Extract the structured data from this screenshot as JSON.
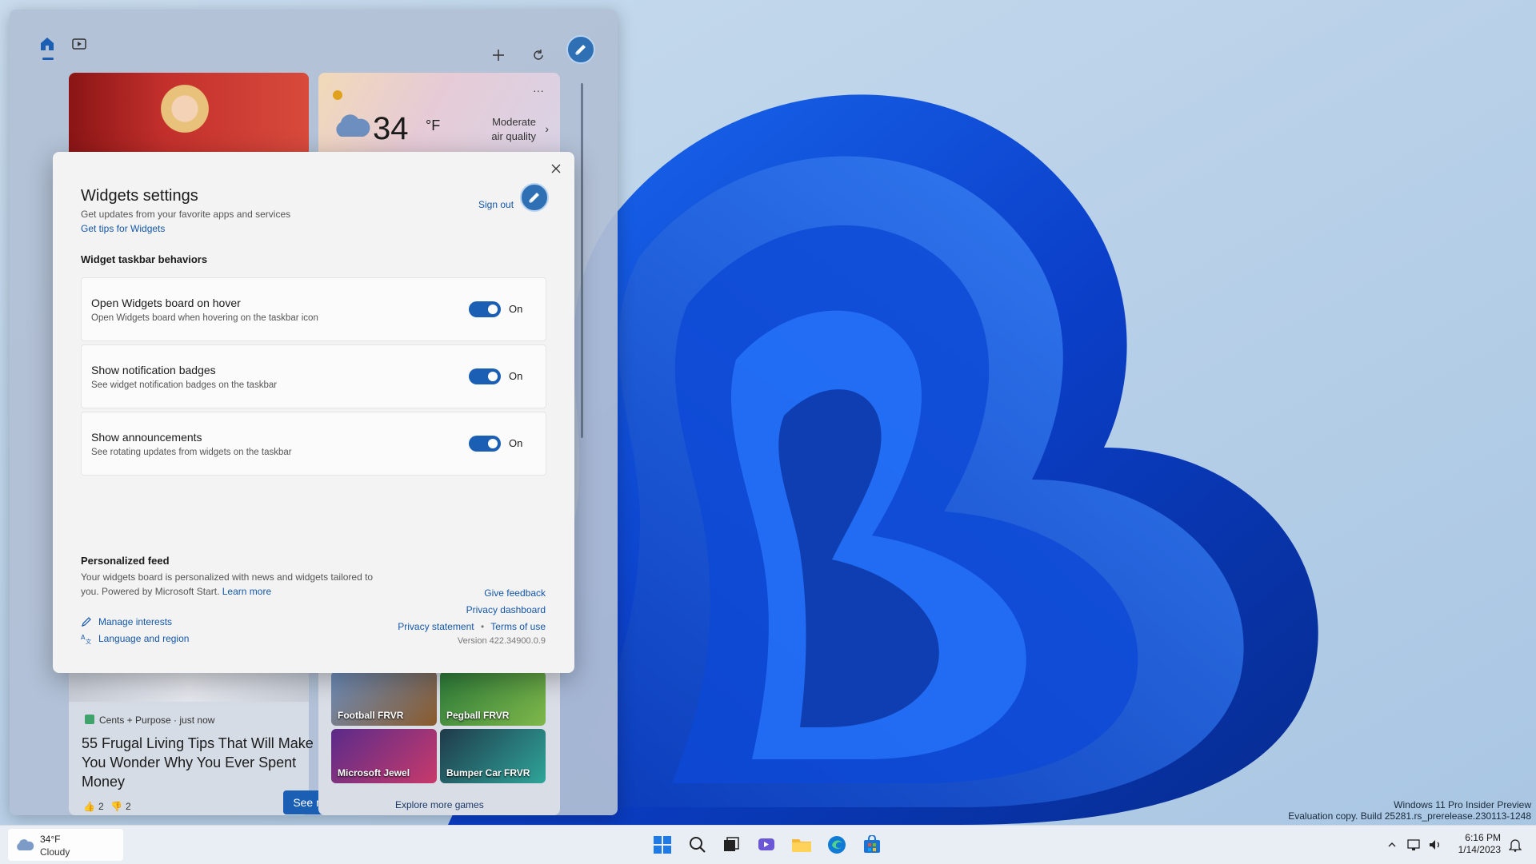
{
  "watermark": {
    "line1": "Windows 11 Pro Insider Preview",
    "line2": "Evaluation copy. Build 25281.rs_prerelease.230113-1248"
  },
  "board": {
    "tabs": [
      {
        "name": "home-icon",
        "active": true
      },
      {
        "name": "video-icon",
        "active": false
      }
    ],
    "weather": {
      "temp": "34",
      "unit": "°F",
      "air_quality_line1": "Moderate",
      "air_quality_line2": "air quality",
      "more": "···"
    },
    "news": {
      "source": "Cents + Purpose · just now",
      "title": "55 Frugal Living Tips That Will Make You Wonder Why You Ever Spent Money",
      "likes": "2",
      "dislikes": "2"
    },
    "see_more": "See more",
    "games": [
      "Football FRVR",
      "Pegball FRVR",
      "Microsoft Jewel",
      "Bumper Car FRVR"
    ],
    "explore_games": "Explore more games"
  },
  "dialog": {
    "title": "Widgets settings",
    "subtitle": "Get updates from your favorite apps and services",
    "tips_link": "Get tips for Widgets",
    "sign_out": "Sign out",
    "section_behaviors": "Widget taskbar behaviors",
    "settings": [
      {
        "title": "Open Widgets board on hover",
        "desc": "Open Widgets board when hovering on the taskbar icon",
        "state": "On"
      },
      {
        "title": "Show notification badges",
        "desc": "See widget notification badges on the taskbar",
        "state": "On"
      },
      {
        "title": "Show announcements",
        "desc": "See rotating updates from widgets on the taskbar",
        "state": "On"
      }
    ],
    "section_feed": "Personalized feed",
    "feed_desc": "Your widgets board is personalized with news and widgets tailored to you. Powered by Microsoft Start.",
    "learn_more": "Learn more",
    "manage_interests": "Manage interests",
    "language_region": "Language and region",
    "give_feedback": "Give feedback",
    "privacy_dashboard": "Privacy dashboard",
    "privacy_statement": "Privacy statement",
    "terms_of_use": "Terms of use",
    "version": "Version 422.34900.0.9"
  },
  "taskbar": {
    "weather_temp": "34°F",
    "weather_cond": "Cloudy",
    "time": "6:16 PM",
    "date": "1/14/2023",
    "accent": "#1a5fb4"
  }
}
